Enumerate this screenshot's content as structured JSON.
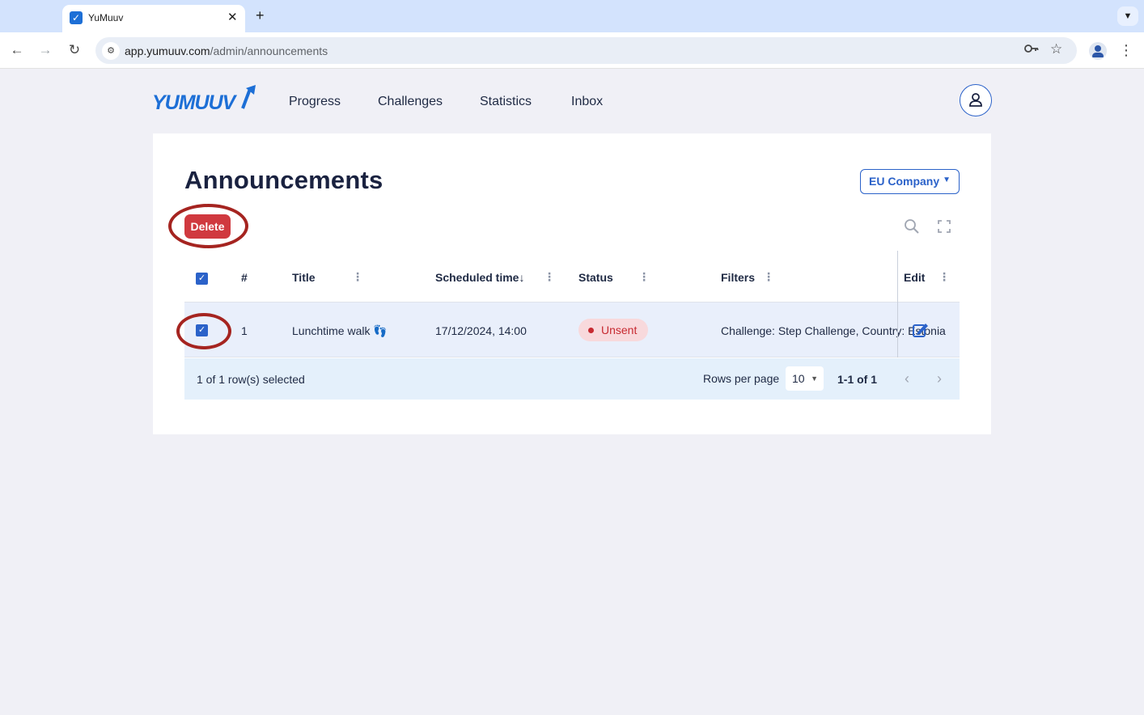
{
  "browser": {
    "tab_title": "YuMuuv",
    "tab_favicon_glyph": "✓",
    "url_host": "app.yumuuv.com",
    "url_path": "/admin/announcements"
  },
  "app": {
    "logo_text": "YUMUUV",
    "nav": [
      "Progress",
      "Challenges",
      "Statistics",
      "Inbox"
    ]
  },
  "page": {
    "title": "Announcements",
    "company_select": "EU Company",
    "delete_label": "Delete"
  },
  "table": {
    "columns": {
      "number": "#",
      "title": "Title",
      "scheduled": "Scheduled time",
      "scheduled_sort": "↓",
      "status": "Status",
      "filters": "Filters",
      "edit": "Edit"
    },
    "rows": [
      {
        "number": "1",
        "title": "Lunchtime walk 👣",
        "scheduled": "17/12/2024, 14:00",
        "status": "Unsent",
        "filters": "Challenge: Step Challenge, Country: Estonia",
        "selected": true
      }
    ],
    "footer": {
      "selection": "1 of 1 row(s) selected",
      "rows_per_page_label": "Rows per page",
      "rows_per_page_value": "10",
      "range": "1-1 of 1"
    }
  },
  "colors": {
    "accent": "#2b62c9",
    "danger": "#d0393f",
    "annotation_ring": "#a52420",
    "selected_row": "#e9effb"
  }
}
